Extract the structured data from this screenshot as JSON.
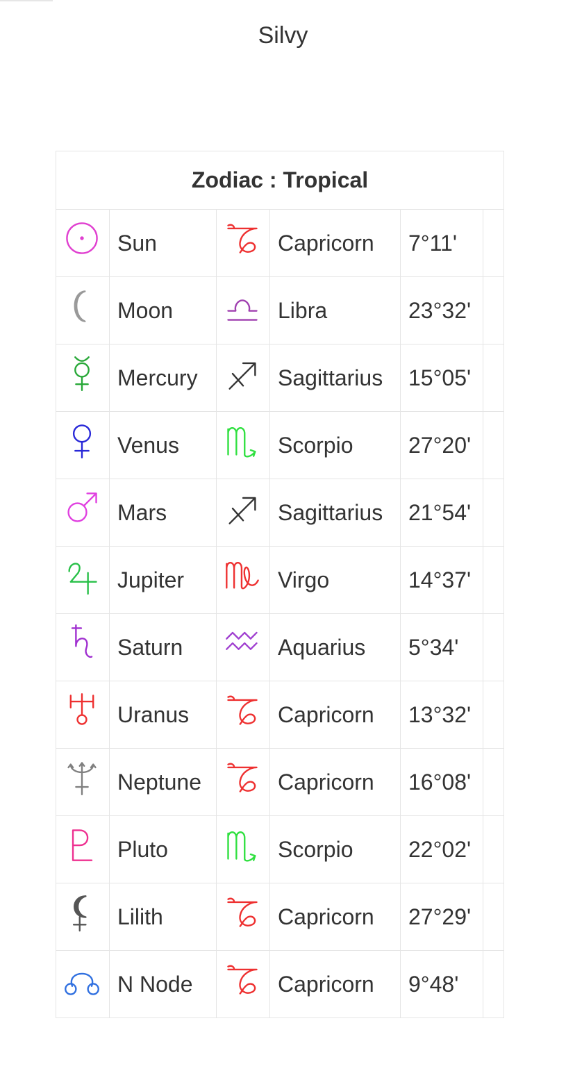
{
  "page_title": "Silvy",
  "table": {
    "header": "Zodiac : Tropical",
    "rows": [
      {
        "planet": "Sun",
        "planet_icon": "sun-icon",
        "planet_color": "#e040d0",
        "sign": "Capricorn",
        "sign_icon": "capricorn-icon",
        "sign_color": "#ee3030",
        "degree": "7°11'"
      },
      {
        "planet": "Moon",
        "planet_icon": "moon-icon",
        "planet_color": "#999999",
        "sign": "Libra",
        "sign_icon": "libra-icon",
        "sign_color": "#a040b0",
        "degree": "23°32'"
      },
      {
        "planet": "Mercury",
        "planet_icon": "mercury-icon",
        "planet_color": "#28a838",
        "sign": "Sagittarius",
        "sign_icon": "sagittarius-icon",
        "sign_color": "#333333",
        "degree": "15°05'"
      },
      {
        "planet": "Venus",
        "planet_icon": "venus-icon",
        "planet_color": "#2828d8",
        "sign": "Scorpio",
        "sign_icon": "scorpio-icon",
        "sign_color": "#30e040",
        "degree": "27°20'"
      },
      {
        "planet": "Mars",
        "planet_icon": "mars-icon",
        "planet_color": "#e040e0",
        "sign": "Sagittarius",
        "sign_icon": "sagittarius-icon",
        "sign_color": "#333333",
        "degree": "21°54'"
      },
      {
        "planet": "Jupiter",
        "planet_icon": "jupiter-icon",
        "planet_color": "#28c048",
        "sign": "Virgo",
        "sign_icon": "virgo-icon",
        "sign_color": "#ee3030",
        "degree": "14°37'"
      },
      {
        "planet": "Saturn",
        "planet_icon": "saturn-icon",
        "planet_color": "#a030d0",
        "sign": "Aquarius",
        "sign_icon": "aquarius-icon",
        "sign_color": "#a040d0",
        "degree": "5°34'"
      },
      {
        "planet": "Uranus",
        "planet_icon": "uranus-icon",
        "planet_color": "#ee3030",
        "sign": "Capricorn",
        "sign_icon": "capricorn-icon",
        "sign_color": "#ee3030",
        "degree": "13°32'"
      },
      {
        "planet": "Neptune",
        "planet_icon": "neptune-icon",
        "planet_color": "#808080",
        "sign": "Capricorn",
        "sign_icon": "capricorn-icon",
        "sign_color": "#ee3030",
        "degree": "16°08'"
      },
      {
        "planet": "Pluto",
        "planet_icon": "pluto-icon",
        "planet_color": "#ee3090",
        "sign": "Scorpio",
        "sign_icon": "scorpio-icon",
        "sign_color": "#30e040",
        "degree": "22°02'"
      },
      {
        "planet": "Lilith",
        "planet_icon": "lilith-icon",
        "planet_color": "#555555",
        "sign": "Capricorn",
        "sign_icon": "capricorn-icon",
        "sign_color": "#ee3030",
        "degree": "27°29'"
      },
      {
        "planet": "N Node",
        "planet_icon": "north-node-icon",
        "planet_color": "#3070e0",
        "sign": "Capricorn",
        "sign_icon": "capricorn-icon",
        "sign_color": "#ee3030",
        "degree": "9°48'"
      }
    ]
  }
}
